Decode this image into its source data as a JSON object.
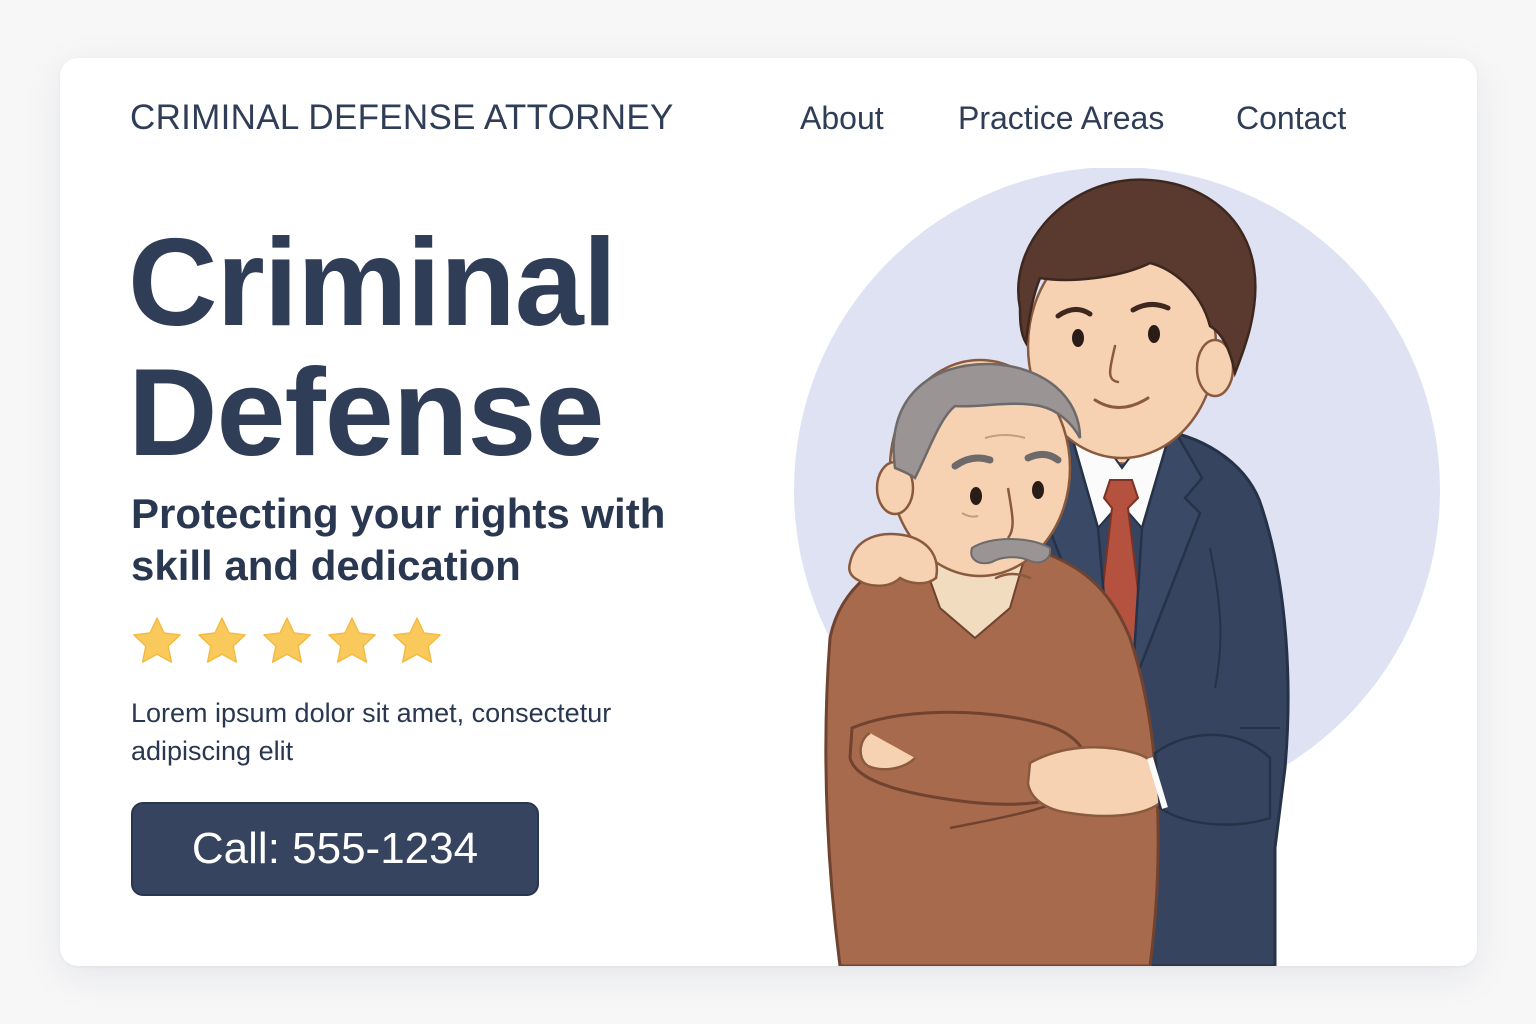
{
  "header": {
    "brand": "CRIMINAL DEFENSE ATTORNEY",
    "nav": {
      "about": "About",
      "practice_areas": "Practice Areas",
      "contact": "Contact"
    }
  },
  "hero": {
    "title_line1": "Criminal",
    "title_line2": "Defense",
    "subtitle": "Protecting your rights with skill and dedication",
    "rating": {
      "value": 5,
      "max": 5,
      "icon": "star-icon",
      "color": "#f9c95b"
    },
    "body": "Lorem ipsum dolor sit amet, consectetur adipiscing elit",
    "cta_label": "Call: 555-1234"
  },
  "illustration": {
    "subject": "attorney-consoling-client",
    "colors": {
      "circle": "#dfe2f3",
      "suit": "#36445f",
      "tie": "#b5523f",
      "sweater": "#a86a4c",
      "skin": "#f6d2b3",
      "hair_young": "#5a3a2e",
      "hair_old": "#9a9494"
    }
  },
  "theme": {
    "primary": "#2f3d57",
    "button_bg": "#36445f",
    "card_bg": "#ffffff",
    "page_bg": "#f7f7f8"
  }
}
